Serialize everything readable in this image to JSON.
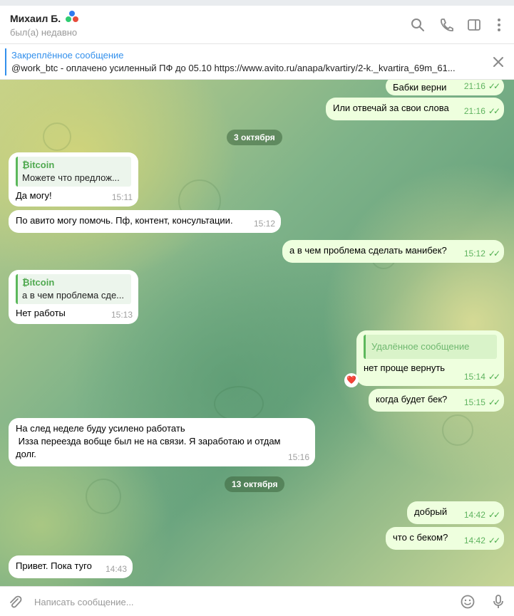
{
  "header": {
    "contact_name": "Михаил Б.",
    "status": "был(а) недавно",
    "icons": [
      "search-icon",
      "phone-icon",
      "sidebar-toggle-icon",
      "more-icon"
    ]
  },
  "pinned": {
    "title": "Закреплённое сообщение",
    "text": "@work_btc - оплачено усиленный ПФ до 05.10  https://www.avito.ru/anapa/kvartiry/2-k._kvartira_69m_61..."
  },
  "messages": {
    "m1": {
      "text": "Бабки верни",
      "time": "21:16"
    },
    "m2": {
      "text": "Или отвечай за свои слова",
      "time": "21:16"
    },
    "date1": "3 октября",
    "m3": {
      "reply_name": "₿itcoin",
      "reply_text": "Можете что предлож...",
      "text": "Да могу!",
      "time": "15:11"
    },
    "m4": {
      "text": "По авито могу помочь. Пф, контент, консультации.",
      "time": "15:12"
    },
    "m5": {
      "text": "а в чем проблема сделать манибек?",
      "time": "15:12"
    },
    "m6": {
      "reply_name": "₿itcoin",
      "reply_text": "а в чем проблема сде...",
      "text": "Нет работы",
      "time": "15:13"
    },
    "m7": {
      "reply_text": "Удалённое сообщение",
      "text": "нет проще вернуть",
      "time": "15:14",
      "reaction": "❤️"
    },
    "m8": {
      "text": "когда будет бек?",
      "time": "15:15"
    },
    "m9": {
      "line1": "На след неделе буду усилено работать",
      "line2": " Изза переезда вобще был не на связи. Я заработаю и отдам",
      "line3": "долг.",
      "time": "15:16"
    },
    "date2": "13 октября",
    "m10": {
      "text": "добрый",
      "time": "14:42"
    },
    "m11": {
      "text": "что с беком?",
      "time": "14:42"
    },
    "m12": {
      "text": "Привет. Пока туго",
      "time": "14:43"
    }
  },
  "composer": {
    "placeholder": "Написать сообщение..."
  },
  "colors": {
    "accent": "#3390ec",
    "outgoing_bubble": "#eeffde",
    "read_ticks": "#4fae4e"
  }
}
